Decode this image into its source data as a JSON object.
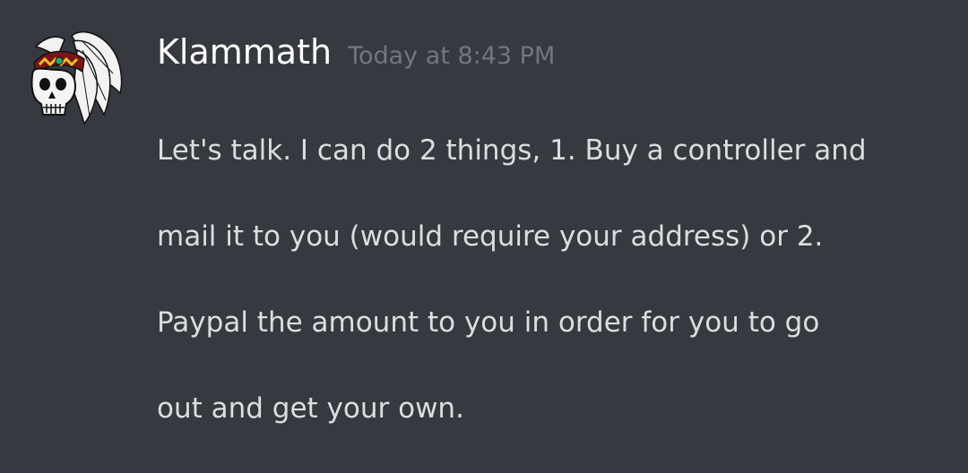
{
  "message": {
    "author": "Klammath",
    "timestamp": "Today at 8:43 PM",
    "lines": [
      "Let's talk. I can do 2 things, 1. Buy a controller and",
      "mail it to you (would require your address) or 2.",
      "Paypal the amount to you in order for you to go",
      "out and get your own."
    ]
  },
  "colors": {
    "background": "#36393f",
    "username": "#ffffff",
    "timestamp": "#72767d",
    "text": "#dcddde"
  },
  "avatar": {
    "icon": "skull-headdress-icon"
  }
}
